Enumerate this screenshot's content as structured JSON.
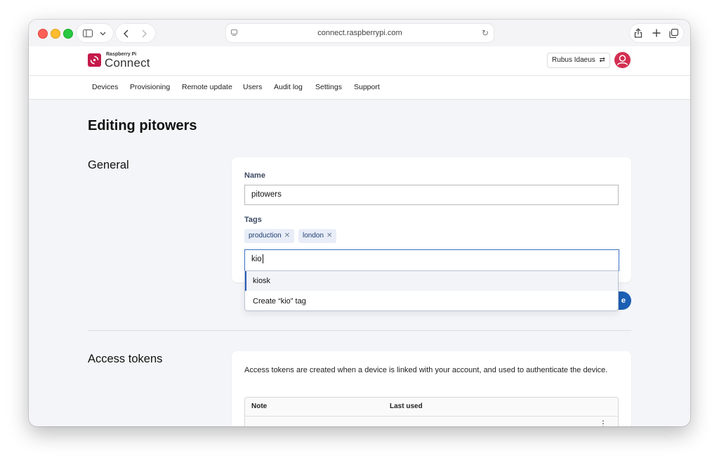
{
  "browser": {
    "url": "connect.raspberrypi.com",
    "icons": [
      "sidebar-icon",
      "chevron-down-icon",
      "back-icon",
      "forward-icon",
      "reload-icon",
      "share-icon",
      "new-tab-icon",
      "tabs-icon"
    ]
  },
  "brand": {
    "small": "Raspberry Pi",
    "name": "Connect",
    "color": "#c51a4a"
  },
  "account": {
    "name": "Rubus Idaeus",
    "switch_glyph": "⇄"
  },
  "nav": {
    "items": [
      "Devices",
      "Provisioning",
      "Remote update",
      "Users",
      "Audit log",
      "Settings",
      "Support"
    ]
  },
  "page": {
    "title": "Editing pitowers"
  },
  "general": {
    "section_title": "General",
    "name_label": "Name",
    "name_value": "pitowers",
    "tags_label": "Tags",
    "tags": [
      "production",
      "london"
    ],
    "tag_input_value": "kio",
    "suggestions": {
      "match": "kiosk",
      "create": "Create “kio” tag"
    },
    "save_label_visible": "e",
    "accent": "#1b5fb4"
  },
  "tokens": {
    "section_title": "Access tokens",
    "description": "Access tokens are created when a device is linked with your account, and used to authenticate the device.",
    "columns": [
      "Note",
      "Last used"
    ]
  }
}
